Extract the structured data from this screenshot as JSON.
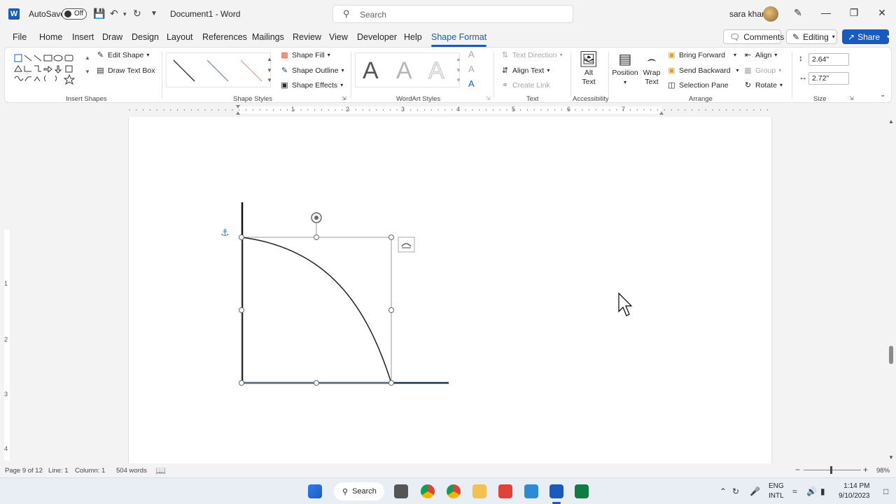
{
  "titlebar": {
    "autosave_label": "AutoSave",
    "autosave_state": "Off",
    "document_title": "Document1 - Word",
    "search_placeholder": "Search",
    "user_name": "sara khan"
  },
  "menu": {
    "tabs": [
      "File",
      "Home",
      "Insert",
      "Draw",
      "Design",
      "Layout",
      "References",
      "Mailings",
      "Review",
      "View",
      "Developer",
      "Help",
      "Shape Format"
    ],
    "active_tab": "Shape Format",
    "comments": "Comments",
    "editing": "Editing",
    "share": "Share"
  },
  "ribbon": {
    "insert_shapes": {
      "label": "Insert Shapes",
      "edit_shape": "Edit Shape",
      "draw_text_box": "Draw Text Box"
    },
    "shape_styles": {
      "label": "Shape Styles",
      "fill": "Shape Fill",
      "outline": "Shape Outline",
      "effects": "Shape Effects"
    },
    "wordart_styles": {
      "label": "WordArt Styles",
      "sample": "A"
    },
    "text": {
      "label": "Text",
      "direction": "Text Direction",
      "align": "Align Text",
      "link": "Create Link"
    },
    "accessibility": {
      "label": "Accessibility",
      "alt_text_1": "Alt",
      "alt_text_2": "Text"
    },
    "arrange": {
      "label": "Arrange",
      "position": "Position",
      "wrap_1": "Wrap",
      "wrap_2": "Text",
      "bring_forward": "Bring Forward",
      "send_backward": "Send Backward",
      "selection_pane": "Selection Pane",
      "align": "Align",
      "group": "Group",
      "rotate": "Rotate"
    },
    "size": {
      "label": "Size",
      "height": "2.64\"",
      "width": "2.72\""
    }
  },
  "ruler": {
    "numbers": [
      "1",
      "2",
      "3",
      "4",
      "5",
      "6",
      "7"
    ],
    "vnumbers": [
      "1",
      "2",
      "3",
      "4"
    ]
  },
  "status": {
    "page": "Page 9 of 12",
    "line": "Line: 1",
    "column": "Column: 1",
    "words": "504 words",
    "zoom": "98%"
  },
  "taskbar": {
    "search": "Search",
    "lang_1": "ENG",
    "lang_2": "INTL",
    "time": "1:14 PM",
    "date": "9/10/2023"
  },
  "colors": {
    "accent": "#185abd",
    "curve": "#1f1f1f",
    "axis_bottom": "#17324d"
  }
}
